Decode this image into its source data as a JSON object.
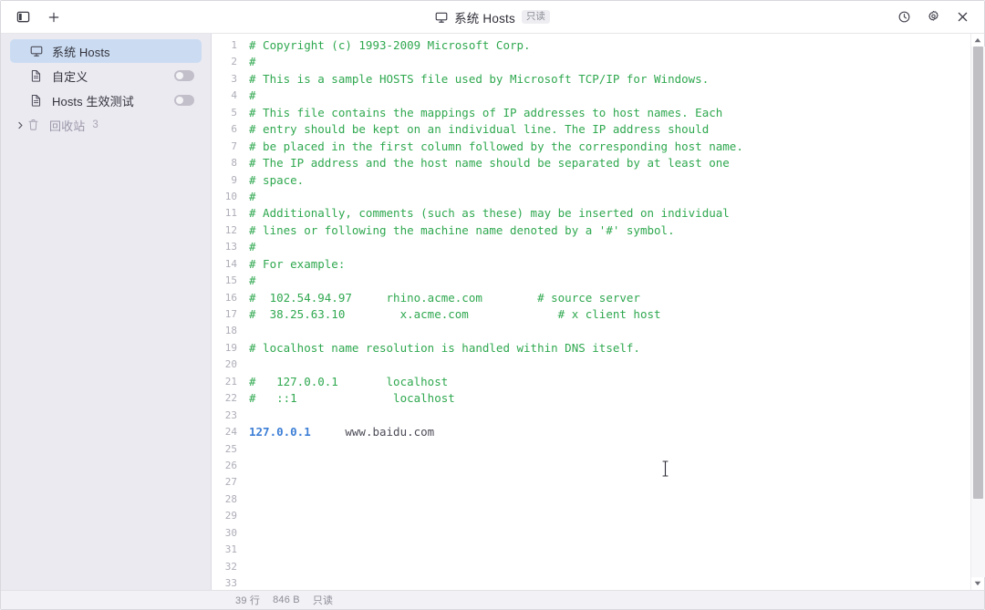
{
  "window": {
    "title": "系统 Hosts",
    "badge": "只读"
  },
  "titlebar": {
    "sidebar_toggle_icon": "sidebar-toggle-icon",
    "new_tab_icon": "plus-icon",
    "monitor_icon": "monitor-icon",
    "history_icon": "history-clock-icon",
    "settings_icon": "gear-icon",
    "close_icon": "close-icon"
  },
  "sidebar": {
    "items": [
      {
        "label": "系统 Hosts",
        "icon": "monitor-icon",
        "selected": true,
        "toggle": null,
        "count": null
      },
      {
        "label": "自定义",
        "icon": "file-icon",
        "selected": false,
        "toggle": "off",
        "count": null
      },
      {
        "label": "Hosts 生效测试",
        "icon": "file-icon",
        "selected": false,
        "toggle": "off",
        "count": null
      },
      {
        "label": "回收站",
        "icon": "trash-icon",
        "selected": false,
        "toggle": null,
        "count": "3"
      }
    ]
  },
  "editor": {
    "first_line": 1,
    "last_visible_line": 33,
    "lines": [
      {
        "n": 1,
        "segments": [
          {
            "type": "comment",
            "text": "# Copyright (c) 1993-2009 Microsoft Corp."
          }
        ]
      },
      {
        "n": 2,
        "segments": [
          {
            "type": "comment",
            "text": "#"
          }
        ]
      },
      {
        "n": 3,
        "segments": [
          {
            "type": "comment",
            "text": "# This is a sample HOSTS file used by Microsoft TCP/IP for Windows."
          }
        ]
      },
      {
        "n": 4,
        "segments": [
          {
            "type": "comment",
            "text": "#"
          }
        ]
      },
      {
        "n": 5,
        "segments": [
          {
            "type": "comment",
            "text": "# This file contains the mappings of IP addresses to host names. Each"
          }
        ]
      },
      {
        "n": 6,
        "segments": [
          {
            "type": "comment",
            "text": "# entry should be kept on an individual line. The IP address should"
          }
        ]
      },
      {
        "n": 7,
        "segments": [
          {
            "type": "comment",
            "text": "# be placed in the first column followed by the corresponding host name."
          }
        ]
      },
      {
        "n": 8,
        "segments": [
          {
            "type": "comment",
            "text": "# The IP address and the host name should be separated by at least one"
          }
        ]
      },
      {
        "n": 9,
        "segments": [
          {
            "type": "comment",
            "text": "# space."
          }
        ]
      },
      {
        "n": 10,
        "segments": [
          {
            "type": "comment",
            "text": "#"
          }
        ]
      },
      {
        "n": 11,
        "segments": [
          {
            "type": "comment",
            "text": "# Additionally, comments (such as these) may be inserted on individual"
          }
        ]
      },
      {
        "n": 12,
        "segments": [
          {
            "type": "comment",
            "text": "# lines or following the machine name denoted by a '#' symbol."
          }
        ]
      },
      {
        "n": 13,
        "segments": [
          {
            "type": "comment",
            "text": "#"
          }
        ]
      },
      {
        "n": 14,
        "segments": [
          {
            "type": "comment",
            "text": "# For example:"
          }
        ]
      },
      {
        "n": 15,
        "segments": [
          {
            "type": "comment",
            "text": "#"
          }
        ]
      },
      {
        "n": 16,
        "segments": [
          {
            "type": "comment",
            "text": "#  102.54.94.97     rhino.acme.com        # source server"
          }
        ]
      },
      {
        "n": 17,
        "segments": [
          {
            "type": "comment",
            "text": "#  38.25.63.10        x.acme.com             # x client host"
          }
        ]
      },
      {
        "n": 18,
        "segments": [
          {
            "type": "blank",
            "text": ""
          }
        ]
      },
      {
        "n": 19,
        "segments": [
          {
            "type": "comment",
            "text": "# localhost name resolution is handled within DNS itself."
          }
        ]
      },
      {
        "n": 20,
        "segments": [
          {
            "type": "blank",
            "text": ""
          }
        ]
      },
      {
        "n": 21,
        "segments": [
          {
            "type": "comment",
            "text": "#   127.0.0.1       localhost"
          }
        ]
      },
      {
        "n": 22,
        "segments": [
          {
            "type": "comment",
            "text": "#   ::1              localhost"
          }
        ]
      },
      {
        "n": 23,
        "segments": [
          {
            "type": "blank",
            "text": ""
          }
        ]
      },
      {
        "n": 24,
        "segments": [
          {
            "type": "ip",
            "text": "127.0.0.1"
          },
          {
            "type": "host",
            "text": "     www.baidu.com"
          }
        ]
      },
      {
        "n": 25,
        "segments": [
          {
            "type": "blank",
            "text": ""
          }
        ]
      },
      {
        "n": 26,
        "segments": [
          {
            "type": "blank",
            "text": ""
          }
        ]
      },
      {
        "n": 27,
        "segments": [
          {
            "type": "blank",
            "text": ""
          }
        ]
      },
      {
        "n": 28,
        "segments": [
          {
            "type": "blank",
            "text": ""
          }
        ]
      },
      {
        "n": 29,
        "segments": [
          {
            "type": "blank",
            "text": ""
          }
        ]
      },
      {
        "n": 30,
        "segments": [
          {
            "type": "blank",
            "text": ""
          }
        ]
      },
      {
        "n": 31,
        "segments": [
          {
            "type": "blank",
            "text": ""
          }
        ]
      },
      {
        "n": 32,
        "segments": [
          {
            "type": "blank",
            "text": ""
          }
        ]
      },
      {
        "n": 33,
        "segments": [
          {
            "type": "blank",
            "text": ""
          }
        ]
      }
    ]
  },
  "statusbar": {
    "line_count": "39 行",
    "size": "846 B",
    "mode": "只读"
  },
  "colors": {
    "accent_selected": "#cbdcf2",
    "comment_green": "#2fa84f",
    "ip_blue": "#3d7fd6",
    "sidebar_bg": "#eceaf1",
    "statusbar_bg": "#f2f1f5"
  }
}
